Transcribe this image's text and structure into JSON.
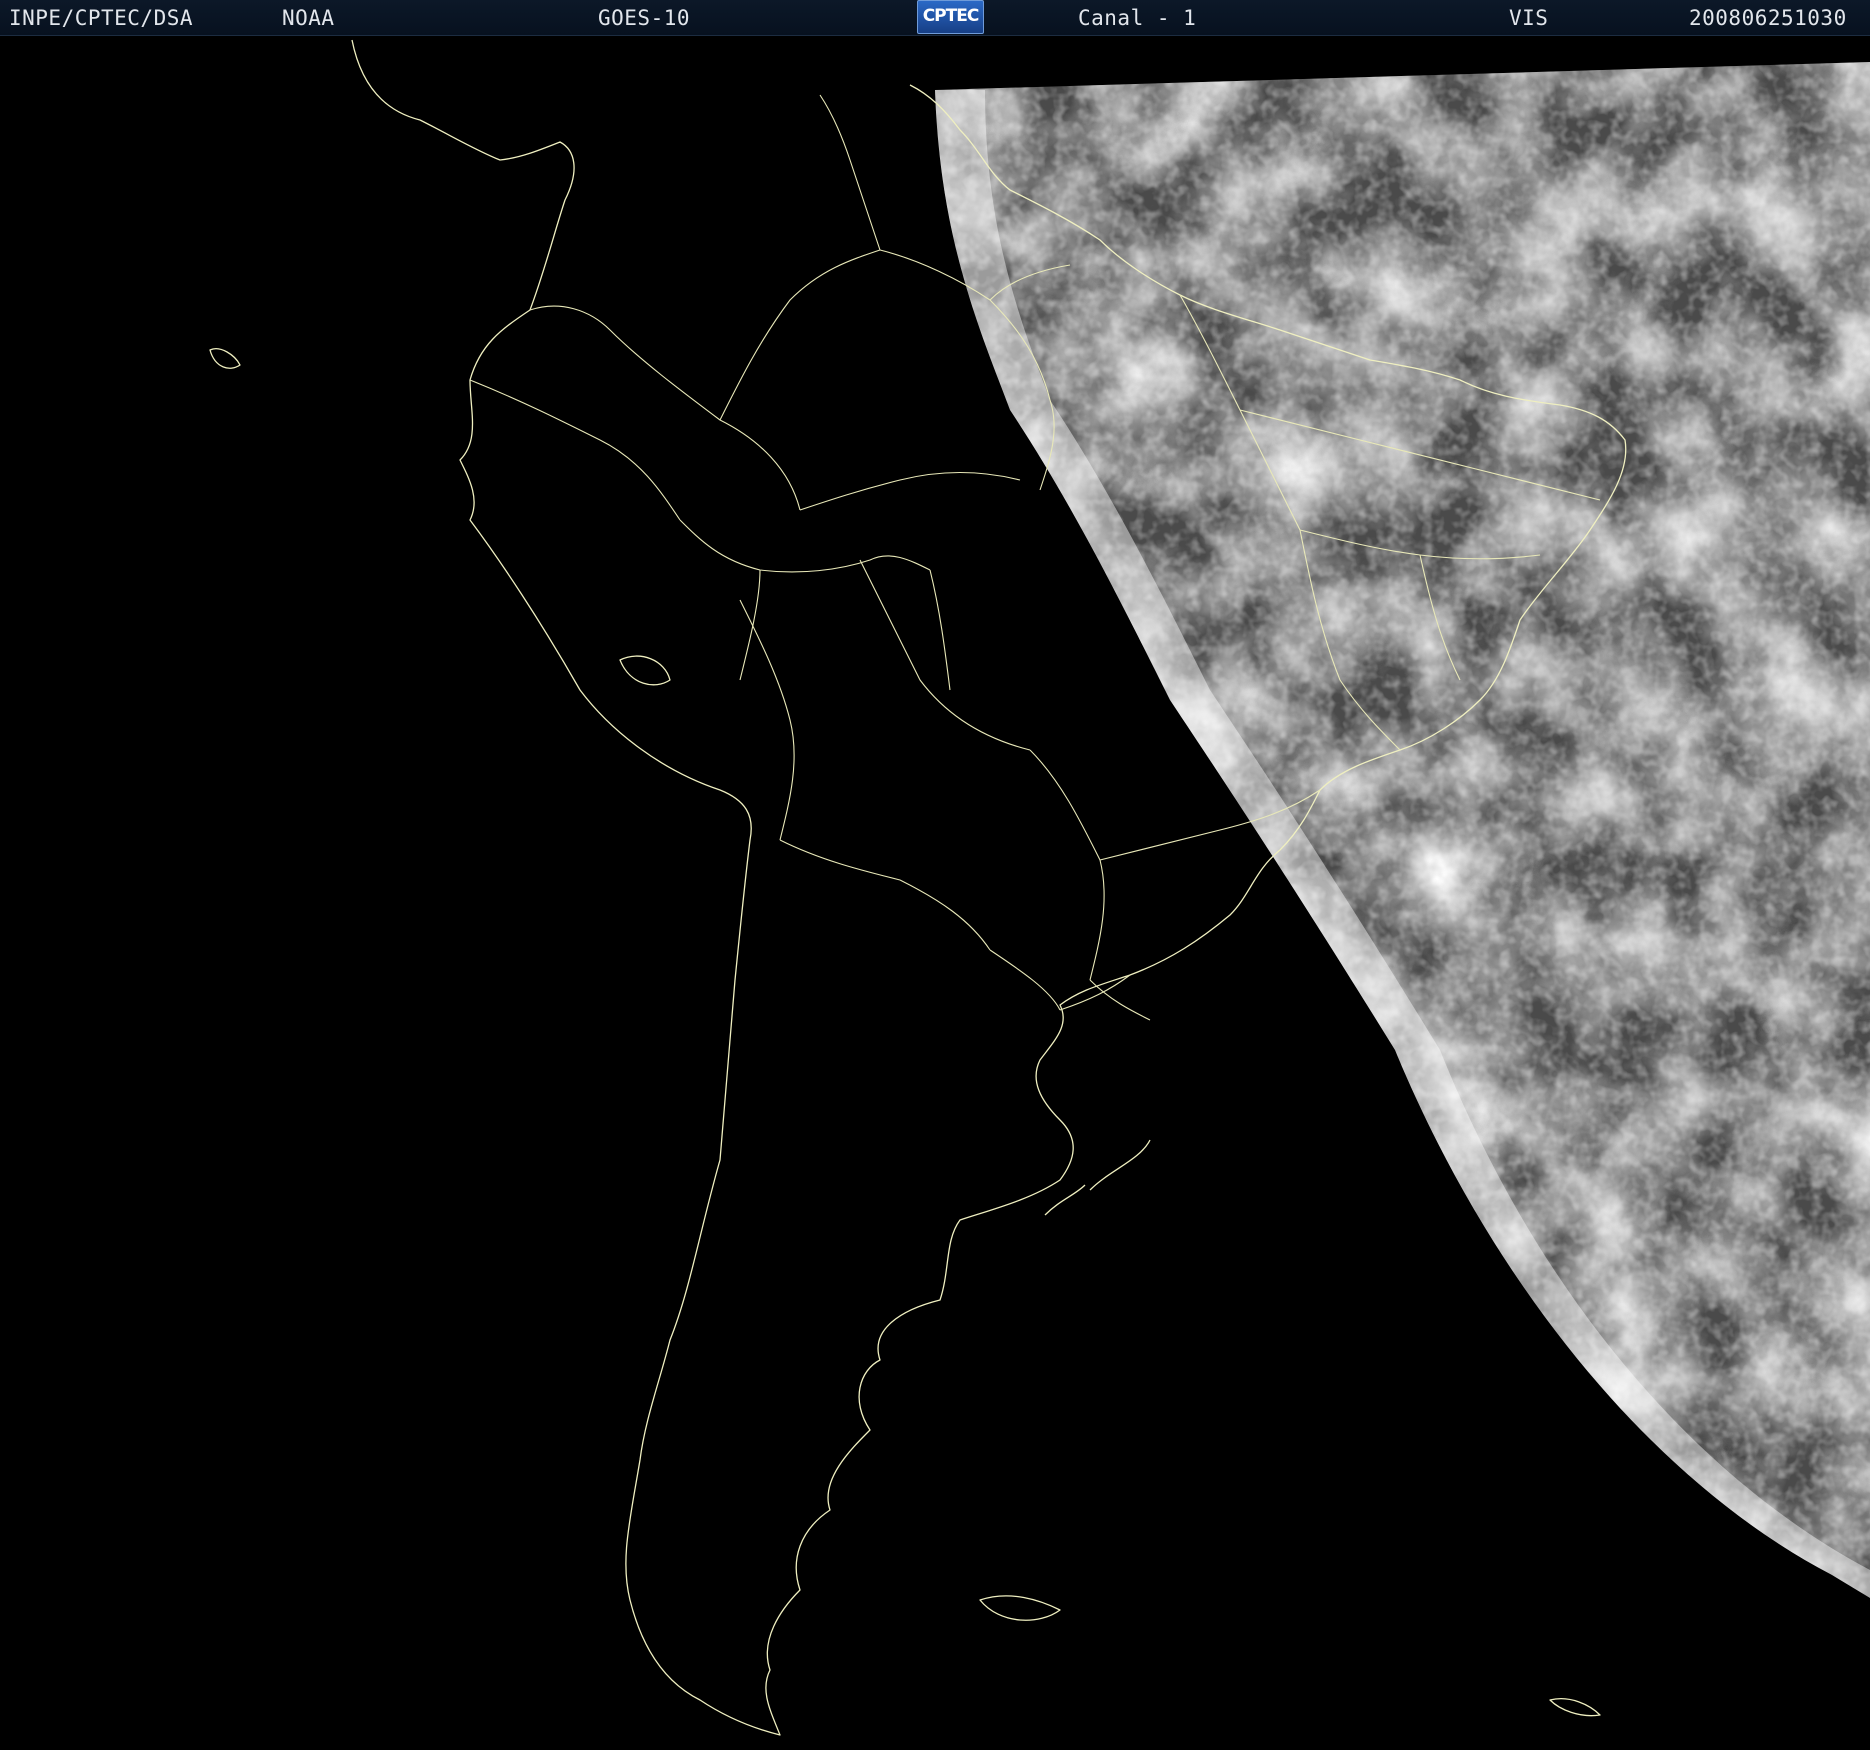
{
  "header": {
    "agency": "INPE/CPTEC/DSA",
    "operator": "NOAA",
    "satellite": "GOES-10",
    "logo_text": "CPTEC",
    "channel": "Canal - 1",
    "band": "VIS",
    "timestamp": "200806251030"
  },
  "colors": {
    "background": "#000000",
    "header_bg": "#0c1828",
    "header_text": "#e2e6ec",
    "coastline": "#efefc0",
    "logo_blue": "#2b69c6"
  },
  "image": {
    "type": "satellite-visible-imagery",
    "region": "South America",
    "illuminated_side": "east"
  }
}
